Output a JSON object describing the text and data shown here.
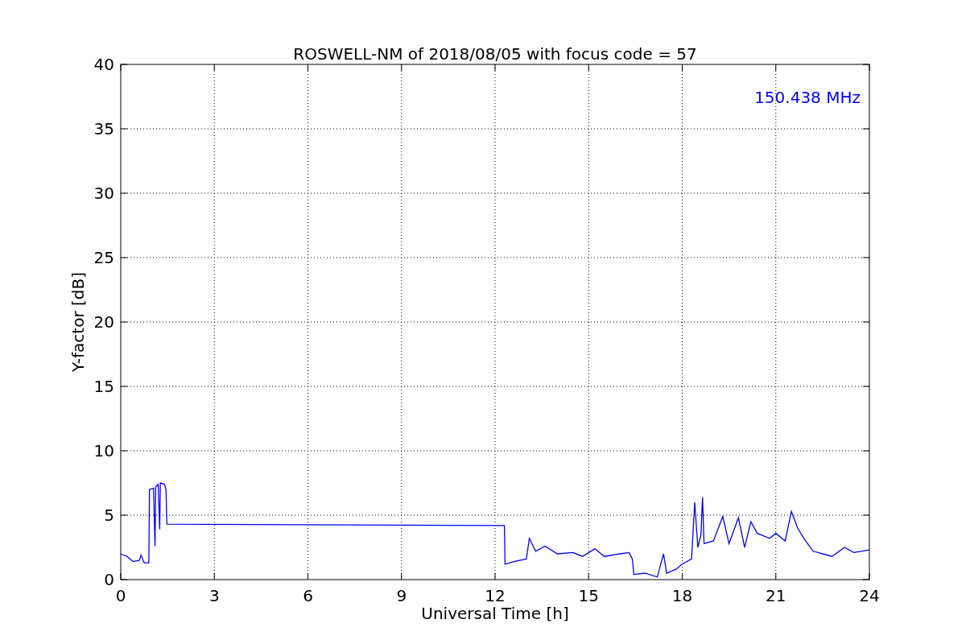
{
  "chart_data": {
    "type": "line",
    "title": "ROSWELL-NM of 2018/08/05 with focus code = 57",
    "xlabel": "Universal Time [h]",
    "ylabel": "Y-factor [dB]",
    "x": [
      0,
      0.2,
      0.4,
      0.6,
      0.65,
      0.75,
      0.9,
      0.92,
      1.05,
      1.1,
      1.12,
      1.2,
      1.25,
      1.27,
      1.4,
      1.45,
      1.48,
      12.3,
      12.32,
      12.6,
      13.0,
      13.1,
      13.3,
      13.6,
      14.0,
      14.5,
      14.8,
      15.2,
      15.5,
      16.0,
      16.3,
      16.4,
      16.45,
      16.8,
      17.2,
      17.4,
      17.5,
      17.8,
      18.0,
      18.3,
      18.4,
      18.5,
      18.6,
      18.65,
      18.7,
      19.0,
      19.3,
      19.5,
      19.8,
      20.0,
      20.2,
      20.4,
      20.8,
      21.0,
      21.3,
      21.5,
      21.7,
      21.9,
      22.2,
      22.5,
      22.8,
      23.2,
      23.5,
      24.0
    ],
    "series": [
      {
        "name": "150.438 MHz",
        "color": "#0000ff",
        "values": [
          2.0,
          1.8,
          1.4,
          1.5,
          1.9,
          1.3,
          1.3,
          7.0,
          7.1,
          2.6,
          7.2,
          7.4,
          3.9,
          7.5,
          7.4,
          7.0,
          4.3,
          4.2,
          1.2,
          1.4,
          1.6,
          3.2,
          2.2,
          2.6,
          2.0,
          2.1,
          1.8,
          2.4,
          1.8,
          2.0,
          2.1,
          1.6,
          0.4,
          0.5,
          0.2,
          2.0,
          0.5,
          0.8,
          1.2,
          1.6,
          6.0,
          2.5,
          3.5,
          6.4,
          2.8,
          3.0,
          4.9,
          2.8,
          4.8,
          2.5,
          4.5,
          3.6,
          3.2,
          3.6,
          3.0,
          5.3,
          4.0,
          3.2,
          2.2,
          2.0,
          1.8,
          2.5,
          2.1,
          2.3
        ]
      }
    ],
    "grid": true,
    "xlim": [
      0,
      24
    ],
    "ylim": [
      0,
      40
    ],
    "xticks": [
      0,
      3,
      6,
      9,
      12,
      15,
      18,
      21,
      24
    ],
    "yticks": [
      0,
      5,
      10,
      15,
      20,
      25,
      30,
      35,
      40
    ]
  }
}
